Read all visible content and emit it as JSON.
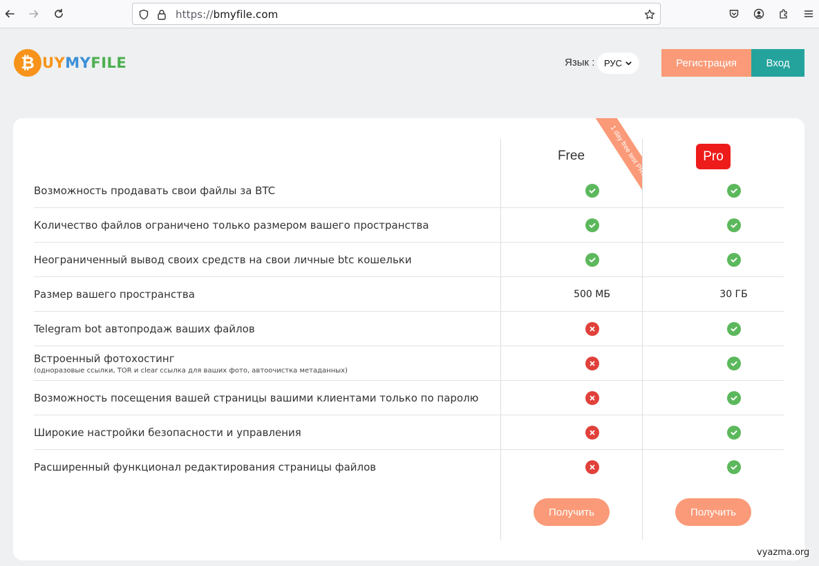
{
  "browser": {
    "url_proto": "https://",
    "url_domain": "bmyfile.com"
  },
  "header": {
    "logo_b": "₿",
    "logo_u": "UY",
    "logo_my": "MY",
    "logo_file": "FILE",
    "lang_label": "Язык :",
    "lang_value": "РУС",
    "register_label": "Регистрация",
    "login_label": "Вход"
  },
  "plans": {
    "free_label": "Free",
    "pro_label": "Pro",
    "ribbon_text": "1 day free test PRO",
    "get_free": "Получить",
    "get_pro": "Получить"
  },
  "features": [
    {
      "label": "Возможность продавать свои файлы за BTC",
      "sub": "",
      "free": "check",
      "pro": "check"
    },
    {
      "label": "Количество файлов ограничено только размером вашего пространства",
      "sub": "",
      "free": "check",
      "pro": "check"
    },
    {
      "label": "Неограниченный вывод своих средств на свои личные btc кошельки",
      "sub": "",
      "free": "check",
      "pro": "check"
    },
    {
      "label": "Размер вашего пространства",
      "sub": "",
      "free": "500 МБ",
      "pro": "30 ГБ"
    },
    {
      "label": "Telegram bot автопродаж ваших файлов",
      "sub": "",
      "free": "cross",
      "pro": "check"
    },
    {
      "label": "Встроенный фотохостинг",
      "sub": "(одноразовые ссылки, TOR и clear ссылка для ваших фото, автоочистка метаданных)",
      "free": "cross",
      "pro": "check"
    },
    {
      "label": "Возможность посещения вашей страницы вашими клиентами только по паролю",
      "sub": "",
      "free": "cross",
      "pro": "check"
    },
    {
      "label": "Широкие настройки безопасности и управления",
      "sub": "",
      "free": "cross",
      "pro": "check"
    },
    {
      "label": "Расширенный функционал редактирования страницы файлов",
      "sub": "",
      "free": "cross",
      "pro": "check"
    }
  ],
  "watermark": "vyazma.org",
  "colors": {
    "accent_orange": "#fa9a78",
    "teal": "#24a39d",
    "pro_red": "#ee1b1b",
    "check_green": "#5cb85c",
    "cross_red": "#e0413a"
  }
}
